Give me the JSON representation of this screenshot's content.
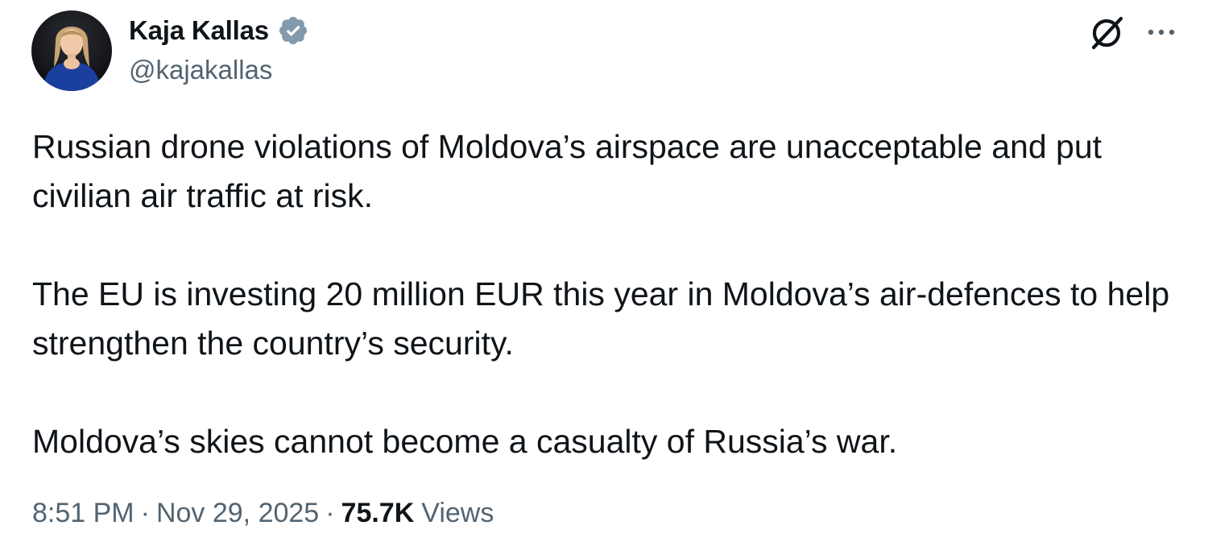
{
  "author": {
    "display_name": "Kaja Kallas",
    "handle": "@kajakallas",
    "verified_icon": "verified-badge-icon",
    "verified_color": "#829aab"
  },
  "header_actions": {
    "grok_icon": "grok-icon",
    "more_icon": "more-options-icon"
  },
  "tweet": {
    "paragraphs": [
      "Russian drone violations of Moldova’s airspace are unacceptable and put civilian air traffic at risk.",
      "The EU is investing 20 million EUR this year in Moldova’s air-defences to help strengthen the country’s security.",
      "Moldova’s skies cannot become a casualty of Russia’s war."
    ]
  },
  "meta": {
    "time": "8:51 PM",
    "separator": "·",
    "date": "Nov 29, 2025",
    "views_count": "75.7K",
    "views_label": "Views"
  },
  "colors": {
    "text_primary": "#0f1419",
    "text_secondary": "#536471",
    "background": "#ffffff"
  }
}
